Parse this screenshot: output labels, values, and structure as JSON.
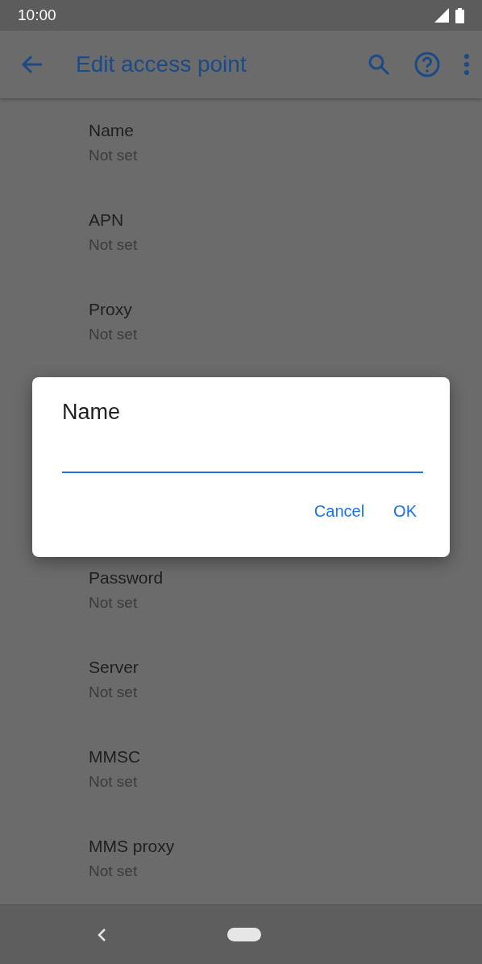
{
  "status_bar": {
    "time": "10:00"
  },
  "app_bar": {
    "title": "Edit access point"
  },
  "settings": [
    {
      "title": "Name",
      "value": "Not set"
    },
    {
      "title": "APN",
      "value": "Not set"
    },
    {
      "title": "Proxy",
      "value": "Not set"
    },
    {
      "title": "Password",
      "value": "Not set"
    },
    {
      "title": "Server",
      "value": "Not set"
    },
    {
      "title": "MMSC",
      "value": "Not set"
    },
    {
      "title": "MMS proxy",
      "value": "Not set"
    }
  ],
  "dialog": {
    "title": "Name",
    "buttons": [
      "Cancel",
      "OK"
    ]
  }
}
